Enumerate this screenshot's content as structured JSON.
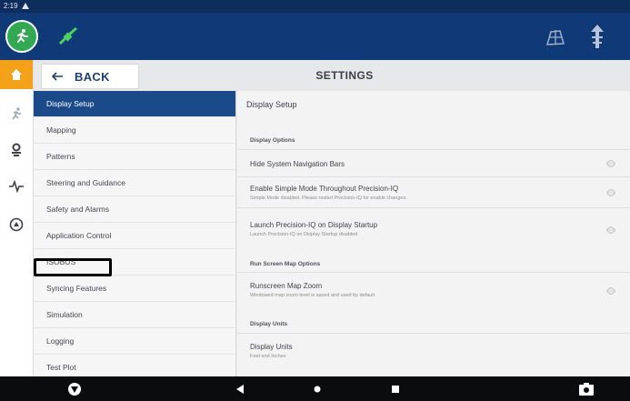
{
  "status_bar": {
    "time": "2:19"
  },
  "colors": {
    "top_bar": "#103a77",
    "accent": "#f4a11a",
    "active_menu": "#1b4a8a",
    "logo_green": "#32a852"
  },
  "top_bar": {
    "icons": [
      "run-logo-icon",
      "satellite-icon",
      "field-boundary-icon",
      "tower-signal-icon"
    ]
  },
  "rail": {
    "items": [
      "home-icon",
      "run-icon",
      "gear-connection-icon",
      "diagnostics-pulse-icon",
      "support-icon"
    ]
  },
  "header": {
    "back_label": "BACK",
    "title": "SETTINGS"
  },
  "menu": {
    "items": [
      {
        "label": "Display Setup",
        "active": true
      },
      {
        "label": "Mapping"
      },
      {
        "label": "Patterns"
      },
      {
        "label": "Steering and Guidance"
      },
      {
        "label": "Safety and Alarms"
      },
      {
        "label": "Application Control"
      },
      {
        "label": "ISOBUS"
      },
      {
        "label": "Syncing Features"
      },
      {
        "label": "Simulation"
      },
      {
        "label": "Logging"
      },
      {
        "label": "Test Plot"
      }
    ]
  },
  "content": {
    "title": "Display Setup",
    "sections": [
      {
        "title": "Display Options"
      },
      {
        "title": "Run Screen Map Options"
      },
      {
        "title": "Display Units"
      }
    ],
    "rows": [
      {
        "title": "Hide System Navigation Bars",
        "subtitle": ""
      },
      {
        "title": "Enable Simple Mode Throughout Precision-IQ",
        "subtitle": "Simple Mode disabled. Please restart Precision-IQ for enable changes."
      },
      {
        "title": "Launch Precision-IQ on Display Startup",
        "subtitle": "Launch Precision-IQ on Display Startup disabled"
      },
      {
        "title": "Runscreen Map Zoom",
        "subtitle": "Windowed map zoom level is saved and used by default"
      },
      {
        "title": "Display Units",
        "subtitle": "Feet and Inches"
      }
    ]
  },
  "nav_bar": {
    "icons": [
      "app-logo-icon",
      "back-triangle-icon",
      "home-circle-icon",
      "recents-square-icon",
      "camera-icon"
    ]
  }
}
